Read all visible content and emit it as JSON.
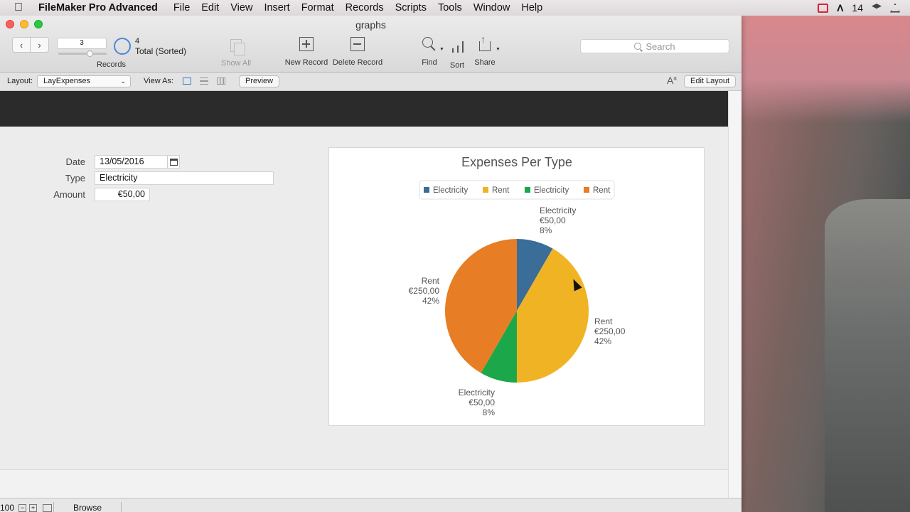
{
  "menubar": {
    "app_name": "FileMaker Pro Advanced",
    "items": [
      "File",
      "Edit",
      "View",
      "Insert",
      "Format",
      "Records",
      "Scripts",
      "Tools",
      "Window",
      "Help"
    ],
    "status_number": "14"
  },
  "window": {
    "title": "graphs"
  },
  "toolbar": {
    "record_number": "3",
    "record_count": "4",
    "record_total": "Total (Sorted)",
    "records_label": "Records",
    "show_all_label": "Show All",
    "new_record_label": "New Record",
    "delete_record_label": "Delete Record",
    "find_label": "Find",
    "sort_label": "Sort",
    "share_label": "Share",
    "search_placeholder": "Search"
  },
  "layoutbar": {
    "layout_label": "Layout:",
    "layout_value": "LayExpenses",
    "view_as_label": "View As:",
    "preview_label": "Preview",
    "edit_layout_label": "Edit Layout"
  },
  "form": {
    "date_label": "Date",
    "date_value": "13/05/2016",
    "type_label": "Type",
    "type_value": "Electricity",
    "amount_label": "Amount",
    "amount_value": "€50,00"
  },
  "chart_data": {
    "type": "pie",
    "title": "Expenses Per Type",
    "legend_position": "top",
    "legend": [
      "Electricity",
      "Rent",
      "Electricity",
      "Rent"
    ],
    "categories": [
      "Electricity",
      "Rent",
      "Electricity",
      "Rent"
    ],
    "values": [
      50,
      250,
      50,
      250
    ],
    "value_labels": [
      "€50,00",
      "€250,00",
      "€50,00",
      "€250,00"
    ],
    "percent_labels": [
      "8%",
      "42%",
      "8%",
      "42%"
    ],
    "colors": [
      "#3a6d97",
      "#f0b323",
      "#1ca84a",
      "#e77d24"
    ]
  },
  "statusbar": {
    "zoom": "100",
    "mode": "Browse"
  }
}
